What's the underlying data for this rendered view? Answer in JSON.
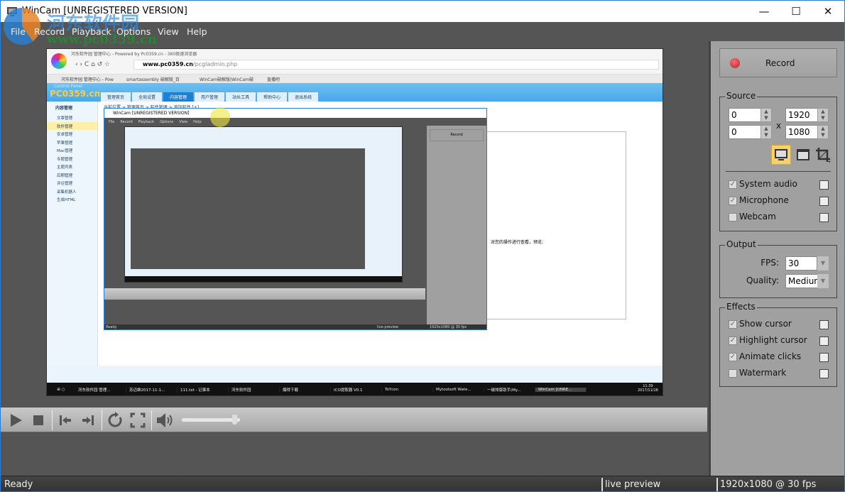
{
  "window": {
    "title": "WinCam  [UNREGISTERED VERSION]",
    "controls": {
      "minimize": "—",
      "maximize": "☐",
      "close": "✕"
    }
  },
  "menu": [
    "File",
    "Record",
    "Playback",
    "Options",
    "View",
    "Help"
  ],
  "watermark": {
    "name": "河东软件园",
    "url": "www.pc0359.cn"
  },
  "preview": {
    "browser_title": "河东软件园 管理中心 - Powered by Pc0359.cn - 360极速浏览器",
    "url_bold": "www.pc0359.cn",
    "url_rest": "/pcgladmin.php",
    "tabs": [
      "河东软件园 管理中心 - Pow",
      "smartassembly 破解版_百",
      "WinCam破解版|WinCam破",
      "直播吧"
    ],
    "site_logo": "PC0359.cn",
    "site_sub": "Control Panel",
    "site_nav": [
      "管理首页",
      "全局设置",
      "内容管理",
      "用户管理",
      "站长工具",
      "帮助中心",
      "退出系统"
    ],
    "sidebar_title": "内容管理",
    "sidebar": [
      "文章管理",
      "软件管理",
      "安卓管理",
      "苹果管理",
      "Mac管理",
      "专题管理",
      "主题列表",
      "后期管理",
      "评论管理",
      "采集机器人",
      "生成HTML"
    ],
    "breadcrumb": "当前位置 > 管理首页 > 软件管理 > 添加软件 [+]",
    "nested_title": "WinCam  [UNREGISTERED VERSION]",
    "nested_menu": [
      "File",
      "Record",
      "Playback",
      "Options",
      "View",
      "Help"
    ],
    "nested_record": "Record",
    "nested_status": [
      "Ready",
      "live preview",
      "1920x1080 @ 30 fps"
    ],
    "side_text": "对您的操作进行查看，预览;",
    "taskbar": [
      "河东软件园 管理...",
      "苏迈维2017-11-1...",
      "111.txt - 记事本",
      "河东软件园",
      "爆得下载",
      "ICO提取器 V0.1",
      "ToYcon",
      "Mytoolsoft Wate...",
      "一键排版助手(My...",
      "WinCam  [UNRE..."
    ],
    "clock": {
      "time": "11:39",
      "date": "2017/11/18"
    }
  },
  "record_button": {
    "label": "Record",
    "color": "#d23a3a"
  },
  "source": {
    "legend": "Source",
    "x": "0",
    "y": "0",
    "width": "1920",
    "height": "1080",
    "times": "x",
    "modes": [
      {
        "icon": "monitor-icon",
        "active": true
      },
      {
        "icon": "window-icon",
        "active": false
      },
      {
        "icon": "crop-icon",
        "active": false
      }
    ],
    "options": [
      {
        "label": "System audio",
        "checked": true
      },
      {
        "label": "Microphone",
        "checked": true
      },
      {
        "label": "Webcam",
        "checked": false
      }
    ]
  },
  "output": {
    "legend": "Output",
    "fps_label": "FPS:",
    "fps": "30",
    "quality_label": "Quality:",
    "quality": "Medium"
  },
  "effects": {
    "legend": "Effects",
    "options": [
      {
        "label": "Show cursor",
        "checked": true
      },
      {
        "label": "Highlight cursor",
        "checked": true
      },
      {
        "label": "Animate clicks",
        "checked": true
      },
      {
        "label": "Watermark",
        "checked": false
      }
    ]
  },
  "playback": {
    "volume": 0.95,
    "icons": [
      "play-icon",
      "stop-icon",
      "skip-start-icon",
      "skip-end-icon",
      "loop-icon",
      "fullscreen-icon",
      "volume-icon"
    ]
  },
  "status": {
    "left": "Ready",
    "middle": "live preview",
    "right": "1920x1080 @ 30 fps"
  },
  "colors": {
    "highlight": "#f7d070",
    "panel": "#a0a0a0",
    "dark": "#555555"
  }
}
